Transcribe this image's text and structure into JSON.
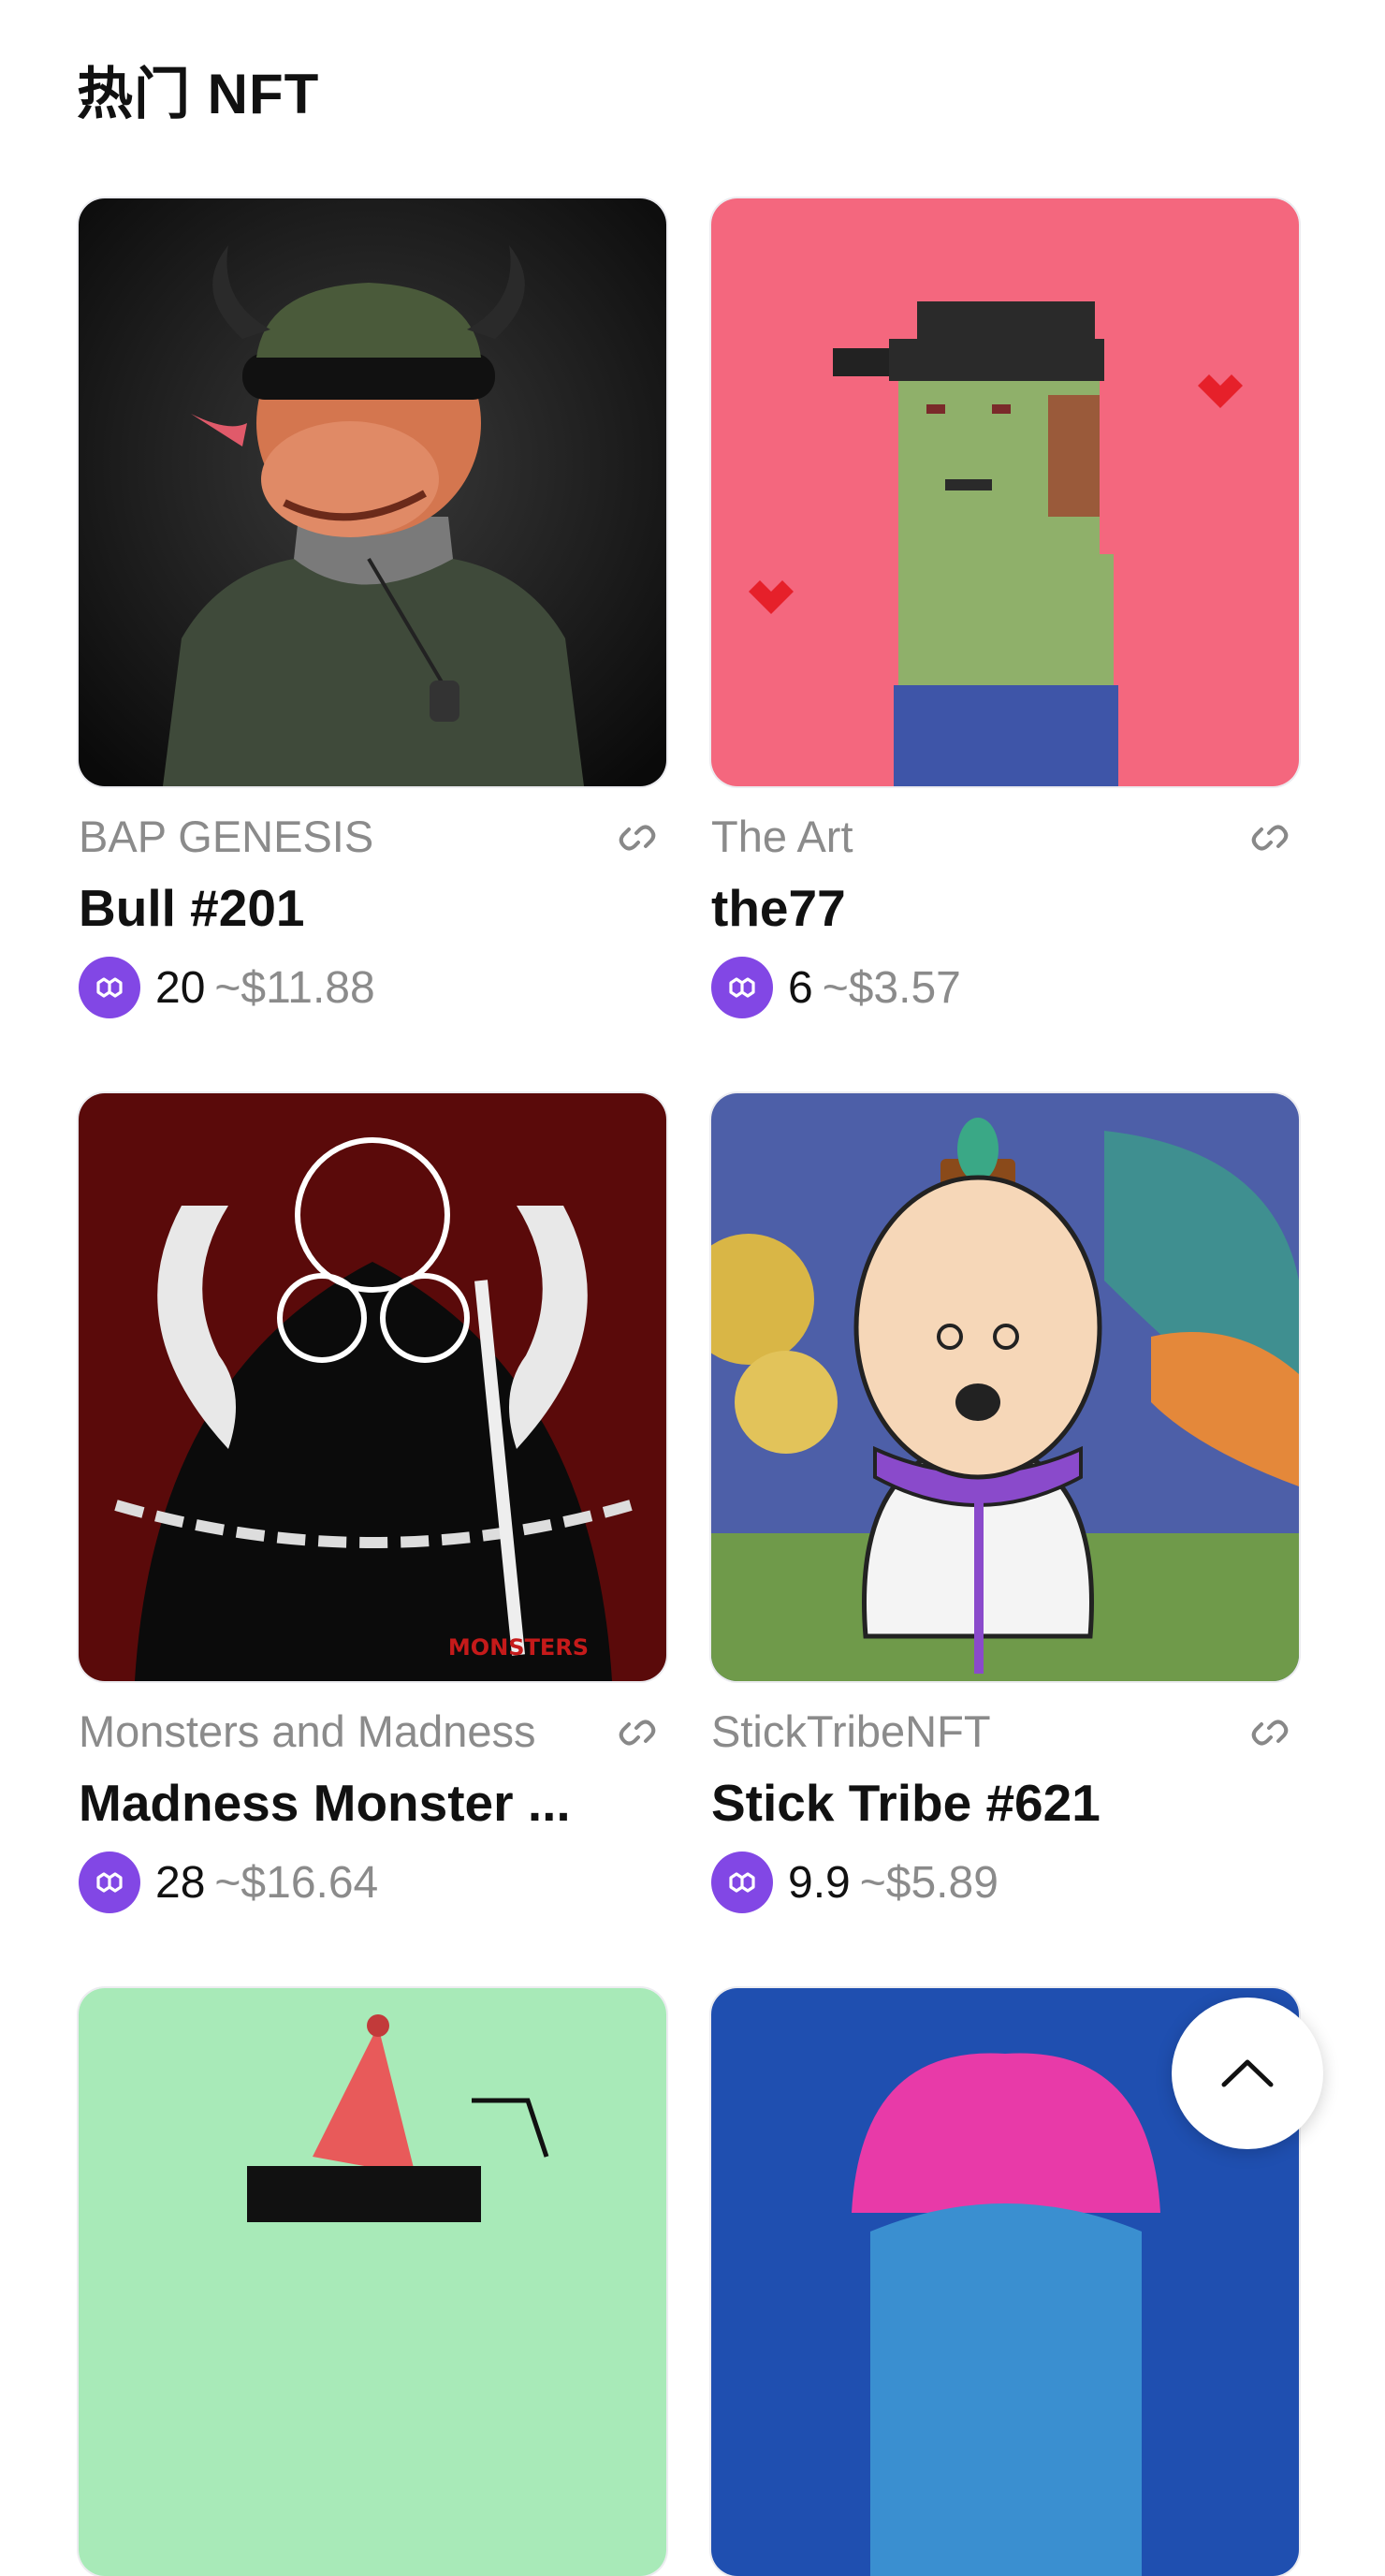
{
  "page": {
    "title": "热门 NFT"
  },
  "nfts": [
    {
      "collection": "BAP GENESIS",
      "name": "Bull #201",
      "price": "20",
      "usd": "~$11.88",
      "artwork": "bull-artwork",
      "bg": "#1a1a1a"
    },
    {
      "collection": "The Art",
      "name": "the77",
      "price": "6",
      "usd": "~$3.57",
      "artwork": "pixel-punk-artwork",
      "bg": "#f4677e"
    },
    {
      "collection": "Monsters and Madness",
      "name": "Madness Monster ...",
      "price": "28",
      "usd": "~$16.64",
      "artwork": "monster-artwork",
      "bg": "#5a0a0a"
    },
    {
      "collection": "StickTribeNFT",
      "name": "Stick Tribe #621",
      "price": "9.9",
      "usd": "~$5.89",
      "artwork": "stick-figure-artwork",
      "bg": "#4d5fa8"
    },
    {
      "collection": "",
      "name": "",
      "price": "",
      "usd": "",
      "artwork": "party-hat-artwork",
      "bg": "#a8eab8"
    },
    {
      "collection": "",
      "name": "",
      "price": "",
      "usd": "",
      "artwork": "pink-hair-artwork",
      "bg": "#1f4fb0"
    }
  ],
  "chain_icon": "polygon-icon",
  "colors": {
    "polygon": "#8247e5",
    "muted_text": "#8b8b8b"
  },
  "scroll_top_icon": "chevron-up-icon"
}
